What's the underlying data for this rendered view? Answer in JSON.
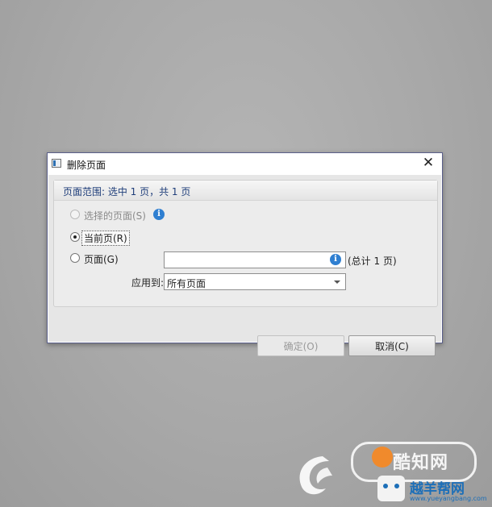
{
  "dialog": {
    "title": "删除页面",
    "close_glyph": "✕",
    "icon": "dialog-app-icon"
  },
  "range": {
    "header": "页面范围: 选中 1 页，共 1 页",
    "option_selected": "选择的页面(S)",
    "option_current": "当前页(R)",
    "option_pages": "页面(G)",
    "pages_value": "",
    "total": "(总计 1 页)",
    "apply_label": "应用到:",
    "apply_value": "所有页面",
    "info_glyph": "i"
  },
  "buttons": {
    "ok": "确定(O)",
    "cancel": "取消(C)"
  },
  "watermark": {
    "brand": "酷知网",
    "sub": "越羊帮网",
    "url": "www.yueyangbang.com"
  },
  "colors": {
    "accent": "#2f7fd1",
    "header_text": "#1f3e7a",
    "watermark_orange": "#f08a2c",
    "watermark_blue": "#1d6fb8"
  }
}
